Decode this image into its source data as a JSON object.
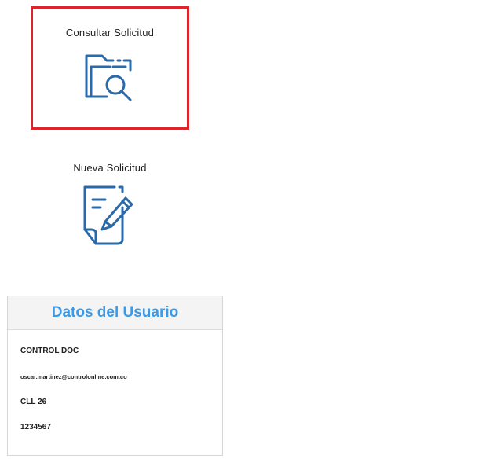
{
  "menu": {
    "consultar": {
      "label": "Consultar Solicitud",
      "icon": "folder-search-icon"
    },
    "nueva": {
      "label": "Nueva Solicitud",
      "icon": "document-edit-icon"
    },
    "highlight_color": "#e0242b",
    "icon_color": "#2a6aa8"
  },
  "user_card": {
    "title": "Datos del Usuario",
    "title_color": "#3a9ae8",
    "name": "CONTROL DOC",
    "email": "oscar.martinez@controlonline.com.co",
    "address": "CLL 26",
    "phone": "1234567"
  }
}
